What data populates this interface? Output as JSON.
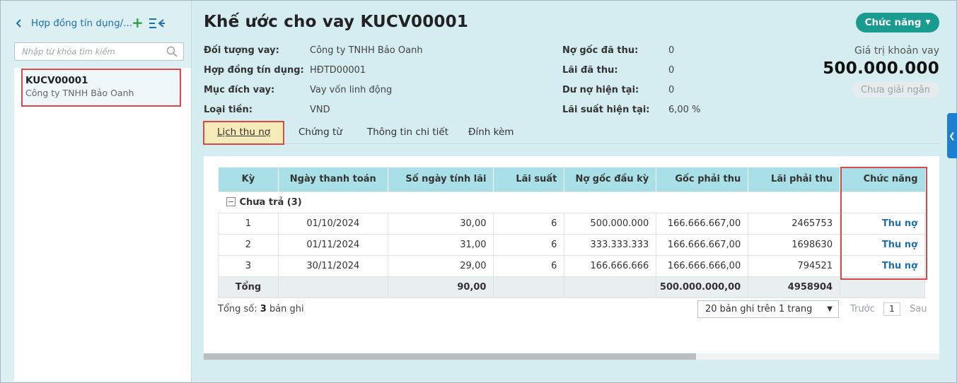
{
  "sidebar": {
    "title": "Hợp đồng tín dụng/...",
    "search_placeholder": "Nhập từ khóa tìm kiếm",
    "items": [
      {
        "code": "KUCV00001",
        "company": "Công ty TNHH Bảo Oanh"
      }
    ]
  },
  "header": {
    "title": "Khế ước cho vay KUCV00001",
    "function_button": "Chức năng"
  },
  "info_left": [
    {
      "label": "Đối tượng vay:",
      "value": "Công ty TNHH Bảo Oanh"
    },
    {
      "label": "Hợp đồng tín dụng:",
      "value": "HĐTD00001"
    },
    {
      "label": "Mục đích vay:",
      "value": "Vay vốn linh động"
    },
    {
      "label": "Loại tiền:",
      "value": "VND"
    }
  ],
  "info_right": [
    {
      "label": "Nợ gốc đã thu:",
      "value": "0"
    },
    {
      "label": "Lãi đã thu:",
      "value": "0"
    },
    {
      "label": "Dư nợ hiện tại:",
      "value": "0"
    },
    {
      "label": "Lãi suất hiện tại:",
      "value": "6,00 %"
    }
  ],
  "loan": {
    "value_label": "Giá trị khoản vay",
    "value": "500.000.000",
    "status": "Chưa giải ngân"
  },
  "tabs": [
    "Lịch thu nợ",
    "Chứng từ",
    "Thông tin chi tiết",
    "Đính kèm"
  ],
  "table": {
    "columns": [
      "Kỳ",
      "Ngày thanh toán",
      "Số ngày tính lãi",
      "Lãi suất",
      "Nợ gốc đầu kỳ",
      "Gốc phải thu",
      "Lãi phải thu",
      "Chức năng"
    ],
    "group_label": "Chưa trả (3)",
    "rows": [
      [
        "1",
        "01/10/2024",
        "30,00",
        "6",
        "500.000.000",
        "166.666.667,00",
        "2465753",
        "Thu nợ"
      ],
      [
        "2",
        "01/11/2024",
        "31,00",
        "6",
        "333.333.333",
        "166.666.667,00",
        "1698630",
        "Thu nợ"
      ],
      [
        "3",
        "30/11/2024",
        "29,00",
        "6",
        "166.666.666",
        "166.666.666,00",
        "794521",
        "Thu nợ"
      ]
    ],
    "total": {
      "label": "Tổng",
      "days": "90,00",
      "principal": "500.000.000,00",
      "interest": "4958904"
    }
  },
  "pagination": {
    "total_prefix": "Tổng số: ",
    "total_count": "3",
    "total_suffix": " bản ghi",
    "page_size": "20 bản ghi trên 1 trang",
    "prev": "Trước",
    "page": "1",
    "next": "Sau"
  },
  "colors": {
    "accent": "#1a9b8f",
    "link": "#1e6fb0",
    "header_bg": "#a9dfe6",
    "highlight": "#d84a4a",
    "active_tab_bg": "#f4ebb9",
    "background": "#d5edf0"
  }
}
